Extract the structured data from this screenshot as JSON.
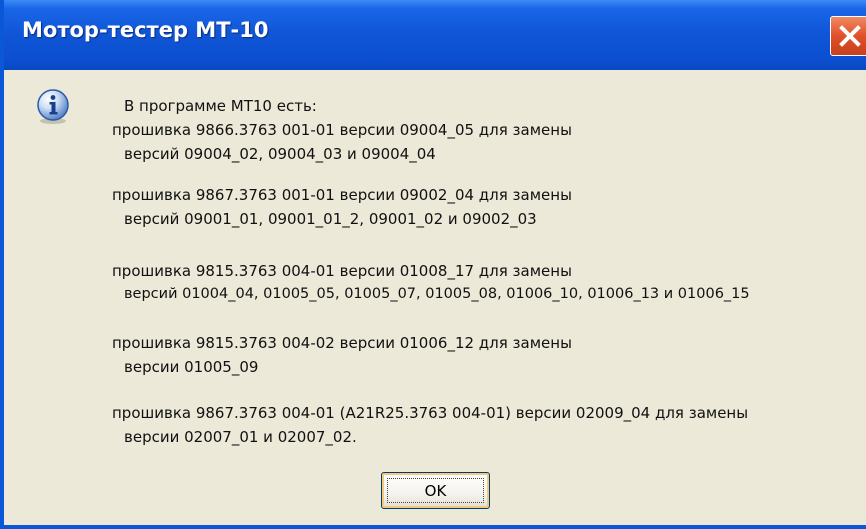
{
  "window": {
    "title": "Мотор-тестер МТ-10",
    "close_icon": "close-icon",
    "accent": "#0b4fd0",
    "close_color": "#e0502a"
  },
  "dialog": {
    "icon": "info-icon",
    "lines": [
      "В программе МТ10 есть:",
      "прошивка 9866.3763 001-01 версии 09004_05 для замены",
      "версий 09004_02, 09004_03 и 09004_04",
      "прошивка 9867.3763 001-01 версии 09002_04 для замены",
      "версий 09001_01, 09001_01_2, 09001_02 и 09002_03",
      "прошивка 9815.3763 004-01 версии 01008_17 для замены",
      "версий 01004_04, 01005_05, 01005_07, 01005_08, 01006_10, 01006_13 и 01006_15",
      "прошивка 9815.3763 004-02 версии 01006_12 для замены",
      "версии 01005_09",
      "прошивка 9867.3763 004-01 (A21R25.3763 004-01) версии 02009_04 для замены",
      "версии 02007_01 и 02007_02."
    ],
    "ok_label": "OK"
  }
}
